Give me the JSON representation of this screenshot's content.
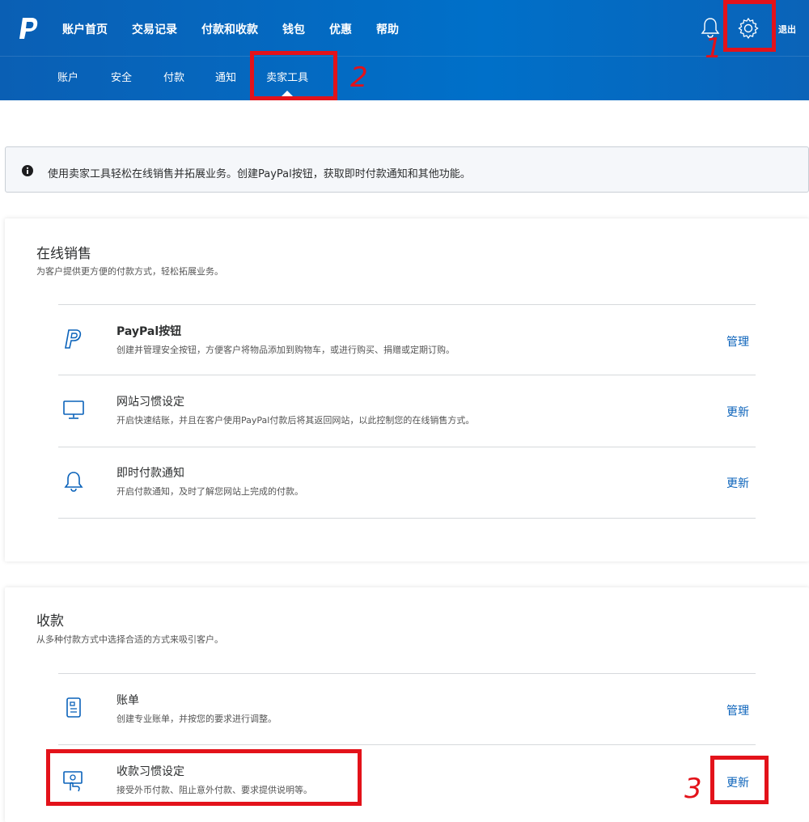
{
  "header": {
    "nav_top": [
      "账户首页",
      "交易记录",
      "付款和收款",
      "钱包",
      "优惠",
      "帮助"
    ],
    "logout": "退出",
    "nav_sub": [
      "账户",
      "安全",
      "付款",
      "通知",
      "卖家工具"
    ]
  },
  "annotations": {
    "n1": "1",
    "n2": "2",
    "n3": "3"
  },
  "notice": {
    "text": "使用卖家工具轻松在线销售并拓展业务。创建PayPal按钮，获取即时付款通知和其他功能。"
  },
  "online_sales": {
    "title": "在线销售",
    "subtitle": "为客户提供更方便的付款方式，轻松拓展业务。",
    "rows": [
      {
        "icon": "paypal-icon",
        "title": "PayPal按钮",
        "desc": "创建并管理安全按钮，方便客户将物品添加到购物车，或进行购买、捐赠或定期订购。",
        "action": "管理"
      },
      {
        "icon": "monitor-icon",
        "title": "网站习惯设定",
        "desc": "开启快速结账，并且在客户使用PayPal付款后将其返回网站，以此控制您的在线销售方式。",
        "action": "更新"
      },
      {
        "icon": "bell-icon",
        "title": "即时付款通知",
        "desc": "开启付款通知，及时了解您网站上完成的付款。",
        "action": "更新"
      }
    ]
  },
  "receive": {
    "title": "收款",
    "subtitle": "从多种付款方式中选择合适的方式来吸引客户。",
    "rows": [
      {
        "icon": "invoice-icon",
        "title": "账单",
        "desc": "创建专业账单，并按您的要求进行调整。",
        "action": "管理"
      },
      {
        "icon": "payment-preferences-icon",
        "title": "收款习惯设定",
        "desc": "接受外币付款、阻止意外付款、要求提供说明等。",
        "action": "更新"
      }
    ]
  },
  "colors": {
    "header": "#0070c9",
    "accent_red": "#e3121a",
    "link": "#0a62ba"
  }
}
